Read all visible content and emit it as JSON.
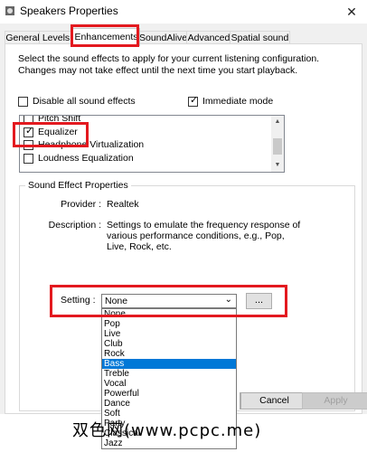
{
  "window": {
    "title": "Speakers Properties",
    "close_glyph": "✕"
  },
  "tabs": [
    {
      "label": "General"
    },
    {
      "label": "Levels"
    },
    {
      "label": "Enhancements"
    },
    {
      "label": "SoundAlive"
    },
    {
      "label": "Advanced"
    },
    {
      "label": "Spatial sound"
    }
  ],
  "enhancements": {
    "description": "Select the sound effects to apply for your current listening configuration. Changes may not take effect until the next time you start playback.",
    "disable_all": {
      "label": "Disable all sound effects",
      "checked": false
    },
    "immediate_mode": {
      "label": "Immediate mode",
      "checked": true
    },
    "effects": [
      {
        "label": "Pitch Shift",
        "checked": false
      },
      {
        "label": "Equalizer",
        "checked": true
      },
      {
        "label": "Headphone Virtualization",
        "checked": false
      },
      {
        "label": "Loudness Equalization",
        "checked": false
      }
    ],
    "properties": {
      "group_title": "Sound Effect Properties",
      "provider_label": "Provider :",
      "provider_value": "Realtek",
      "description_label": "Description :",
      "description_lines": [
        "Settings to emulate the frequency response of",
        "various performance conditions,  e.g., Pop,",
        "Live, Rock, etc."
      ],
      "setting_label": "Setting :",
      "setting_value": "None",
      "setting_arrow": "⌄",
      "more_button": "...",
      "setting_options": [
        "None",
        "Pop",
        "Live",
        "Club",
        "Rock",
        "Bass",
        "Treble",
        "Vocal",
        "Powerful",
        "Dance",
        "Soft",
        "Party",
        "Classical",
        "Jazz"
      ],
      "highlighted_option": "Bass"
    }
  },
  "buttons": {
    "cancel": "Cancel",
    "apply": "Apply"
  },
  "watermark": "双色网(www.pcpc.me)",
  "colors": {
    "highlight_box": "#e3191f",
    "selection": "#0078d7"
  }
}
